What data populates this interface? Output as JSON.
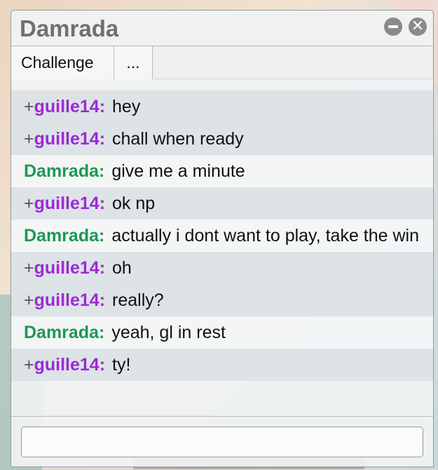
{
  "window": {
    "title": "Damrada",
    "minimize_icon": "minus-circle-icon",
    "close_icon": "close-circle-icon",
    "close_glyph": "✕"
  },
  "tabs": [
    {
      "label": "Challenge"
    },
    {
      "label": "..."
    }
  ],
  "messages": [
    {
      "rank": "+",
      "user": "guille14",
      "text": "hey",
      "style": "alt",
      "color": "#9b2ad6"
    },
    {
      "rank": "+",
      "user": "guille14",
      "text": "chall when ready",
      "style": "alt",
      "color": "#9b2ad6"
    },
    {
      "rank": "",
      "user": "Damrada",
      "text": "give me a minute",
      "style": "plain",
      "color": "#1d9854"
    },
    {
      "rank": "+",
      "user": "guille14",
      "text": "ok np",
      "style": "alt",
      "color": "#9b2ad6"
    },
    {
      "rank": "",
      "user": "Damrada",
      "text": "actually i dont want to play, take the win",
      "style": "plain",
      "color": "#1d9854"
    },
    {
      "rank": "+",
      "user": "guille14",
      "text": "oh",
      "style": "alt",
      "color": "#9b2ad6"
    },
    {
      "rank": "+",
      "user": "guille14",
      "text": "really?",
      "style": "alt",
      "color": "#9b2ad6"
    },
    {
      "rank": "",
      "user": "Damrada",
      "text": "yeah, gl in rest",
      "style": "plain",
      "color": "#1d9854"
    },
    {
      "rank": "+",
      "user": "guille14",
      "text": "ty!",
      "style": "alt",
      "color": "#9b2ad6"
    }
  ],
  "input": {
    "value": "",
    "placeholder": ""
  }
}
